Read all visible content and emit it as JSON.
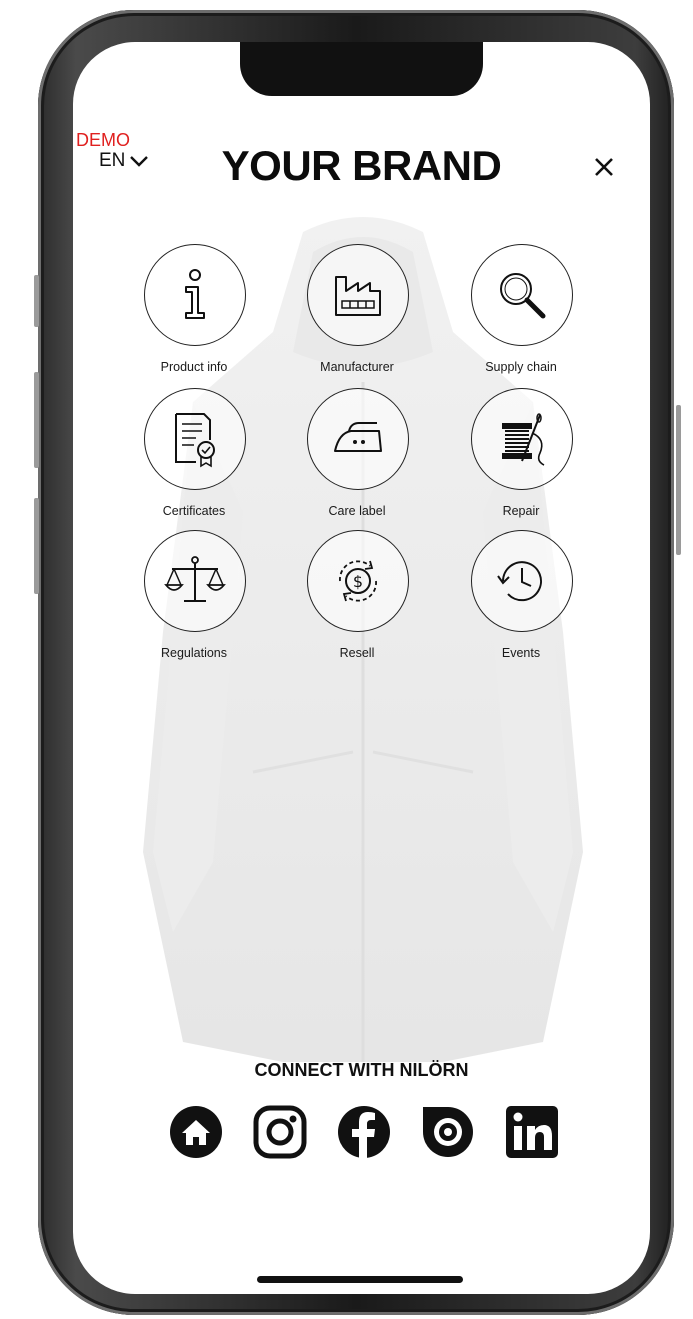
{
  "app": {
    "demo_label": "DEMO",
    "language": "EN",
    "brand_title": "YOUR BRAND"
  },
  "tiles": [
    {
      "label": "Product info",
      "icon": "info-icon"
    },
    {
      "label": "Manufacturer",
      "icon": "factory-icon"
    },
    {
      "label": "Supply chain",
      "icon": "magnifier-icon"
    },
    {
      "label": "Certificates",
      "icon": "certificate-icon"
    },
    {
      "label": "Care label",
      "icon": "iron-icon"
    },
    {
      "label": "Repair",
      "icon": "sewing-thread-icon"
    },
    {
      "label": "Regulations",
      "icon": "scales-icon"
    },
    {
      "label": "Resell",
      "icon": "resell-dollar-icon"
    },
    {
      "label": "Events",
      "icon": "history-clock-icon"
    }
  ],
  "footer": {
    "connect_label": "CONNECT WITH NILÖRN",
    "socials": [
      "home-icon",
      "instagram-icon",
      "facebook-icon",
      "issuu-icon",
      "linkedin-icon"
    ]
  },
  "colors": {
    "demo_red": "#e0201f",
    "text": "#0c0c0c",
    "frame": "#1a1a1a"
  }
}
